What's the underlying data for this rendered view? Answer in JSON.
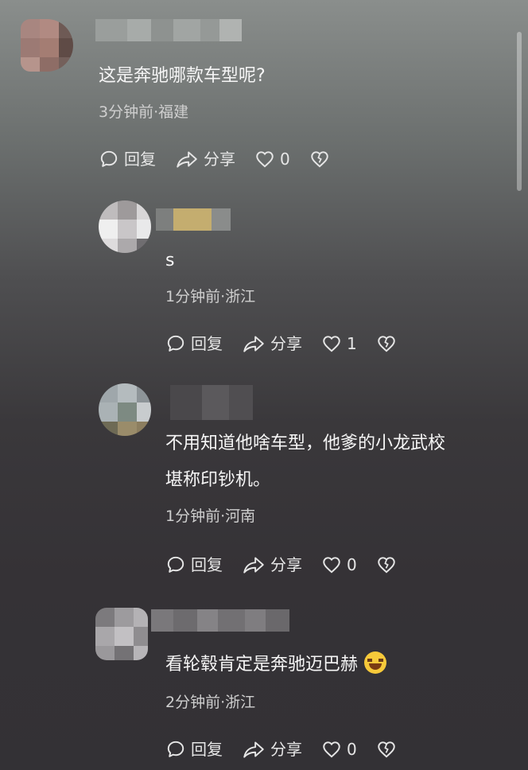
{
  "comments": [
    {
      "text_lines": [
        "这是奔驰哪款车型呢?"
      ],
      "meta": "3分钟前·福建",
      "reply_label": "回复",
      "share_label": "分享",
      "like_count": "0"
    },
    {
      "text_lines": [
        "s"
      ],
      "meta": "1分钟前·浙江",
      "reply_label": "回复",
      "share_label": "分享",
      "like_count": "1"
    },
    {
      "text_lines": [
        "不用知道他啥车型，他爹的小龙武校",
        "堪称印钞机。"
      ],
      "meta": "1分钟前·河南",
      "reply_label": "回复",
      "share_label": "分享",
      "like_count": "0"
    },
    {
      "text_lines": [
        "看轮毂肯定是奔驰迈巴赫"
      ],
      "meta": "2分钟前·浙江",
      "reply_label": "回复",
      "share_label": "分享",
      "like_count": "0",
      "emoji": "laughing-tears-emoji"
    }
  ],
  "icons": {
    "reply": "comment-bubble-icon",
    "share": "share-arrow-icon",
    "like": "heart-icon",
    "dislike": "broken-heart-icon"
  }
}
